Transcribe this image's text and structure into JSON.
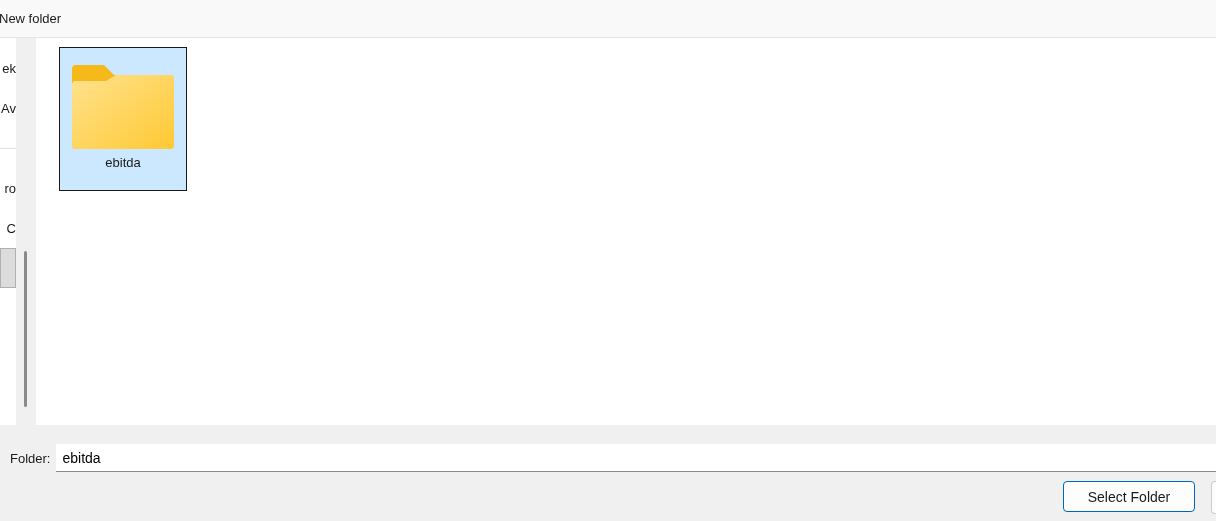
{
  "toolbar": {
    "new_folder": "New folder"
  },
  "sidebar": {
    "items": [
      {
        "label": "ek",
        "selected": false
      },
      {
        "label": "Av",
        "selected": false,
        "divider_after": true
      },
      {
        "label": "ro",
        "selected": false
      },
      {
        "label": "C",
        "selected": false
      },
      {
        "selected": true
      }
    ]
  },
  "files": [
    {
      "name": "ebitda",
      "kind": "folder",
      "selected": true
    }
  ],
  "footer": {
    "folder_label": "Folder:",
    "folder_value": "ebitda",
    "select_button": "Select Folder"
  }
}
